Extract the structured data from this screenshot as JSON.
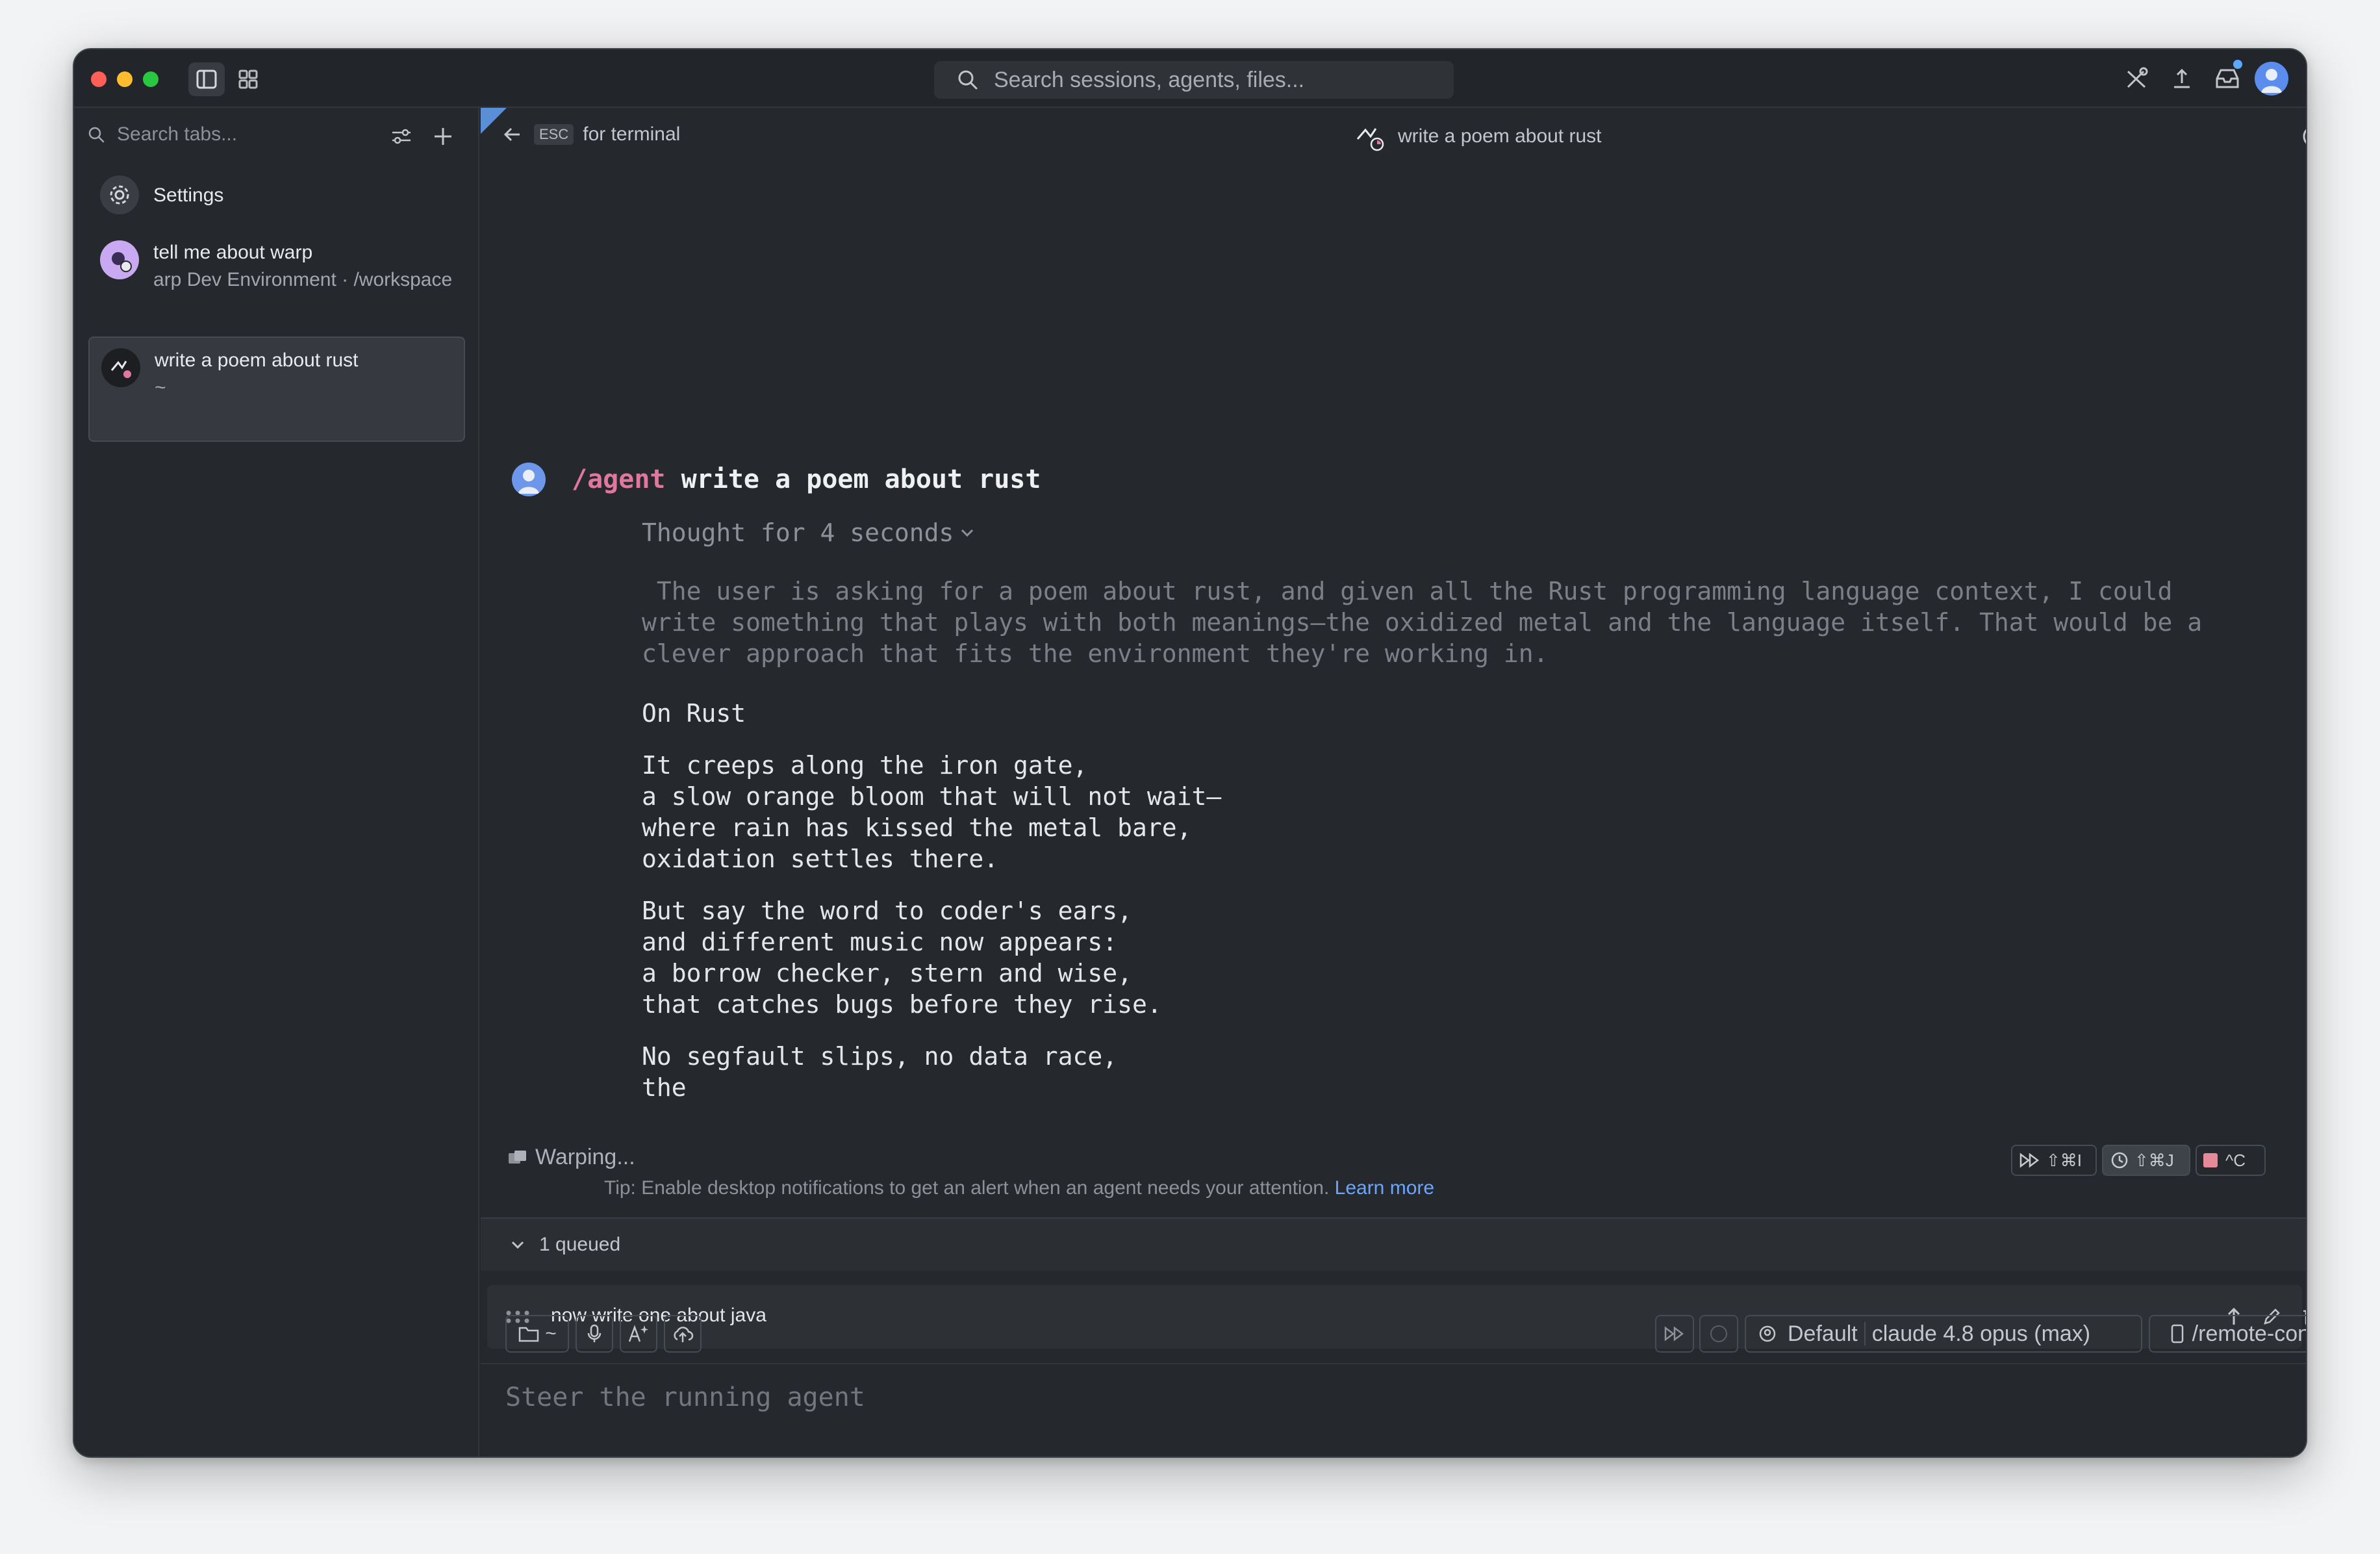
{
  "titlebar": {
    "search_placeholder": "Search sessions, agents, files..."
  },
  "sidebar": {
    "search_placeholder": "Search tabs...",
    "items": [
      {
        "title": "Settings",
        "subtitle": ""
      },
      {
        "title": "tell me about warp",
        "subtitle": "arp Dev Environment · /workspace"
      },
      {
        "title": "write a poem about rust",
        "subtitle": "~"
      }
    ]
  },
  "main": {
    "back_key": "ESC",
    "back_label": "for terminal",
    "session_title": "write a poem about rust",
    "prompt_command": "/agent",
    "prompt_text": " write a poem about rust",
    "thought_label": "Thought for 4 seconds",
    "thinking_text": " The user is asking for a poem about rust, and given all the Rust programming language context, I could\nwrite something that plays with both meanings—the oxidized metal and the language itself. That would be a\nclever approach that fits the environment they're working in.",
    "poem_title": "On Rust",
    "stanza1": "It creeps along the iron gate,\na slow orange bloom that will not wait—\nwhere rain has kissed the metal bare,\noxidation settles there.",
    "stanza2": "But say the word to coder's ears,\nand different music now appears:\na borrow checker, stern and wise,\nthat catches bugs before they rise.",
    "stanza3": "No segfault slips, no data race,\nthe",
    "status": "Warping...",
    "tip_text": "Tip: Enable desktop notifications to get an alert when an agent needs your attention. ",
    "tip_link": "Learn more",
    "shortcut_fast": "⇧⌘I",
    "shortcut_bg": "⇧⌘J",
    "shortcut_stop": "^C",
    "queue_label": "1 queued",
    "queued_message": "now write one about java",
    "input_placeholder": "Steer the running agent",
    "dir_label": "~",
    "profile": "Default",
    "model": "claude 4.8 opus (max)",
    "remote": "/remote-control"
  },
  "colors": {
    "accent_pink": "#e0779d",
    "link_blue": "#6aa6ff",
    "background": "#25282c"
  }
}
